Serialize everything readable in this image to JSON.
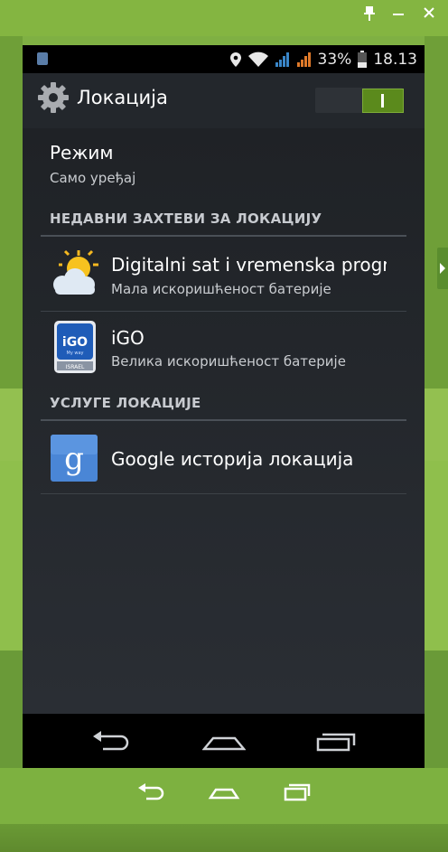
{
  "statusbar": {
    "battery_percent": "33%",
    "time": "18.13"
  },
  "actionbar": {
    "title": "Локација",
    "switch_state": "on"
  },
  "mode": {
    "title": "Режим",
    "value": "Само уређај"
  },
  "recent_requests": {
    "header": "НЕДАВНИ ЗАХТЕВИ ЗА ЛОКАЦИЈУ",
    "items": [
      {
        "title": "Digitalni sat i vremenska progr",
        "subtitle": "Мала искоришћеност батерије",
        "icon": "weather-sun-cloud-icon"
      },
      {
        "title": "iGO",
        "subtitle": "Велика искоришћеност батерије",
        "icon": "igo-app-icon"
      }
    ]
  },
  "igo_icon": {
    "brand": "iGO",
    "tagline": "My way",
    "region": "ISRAEL"
  },
  "services": {
    "header": "УСЛУГЕ ЛОКАЦИЈЕ",
    "items": [
      {
        "title": "Google историја локација",
        "icon": "google-g-icon"
      }
    ]
  },
  "colors": {
    "accent": "#5b8a1c",
    "frame": "#84b541",
    "background": "#1f2226"
  }
}
